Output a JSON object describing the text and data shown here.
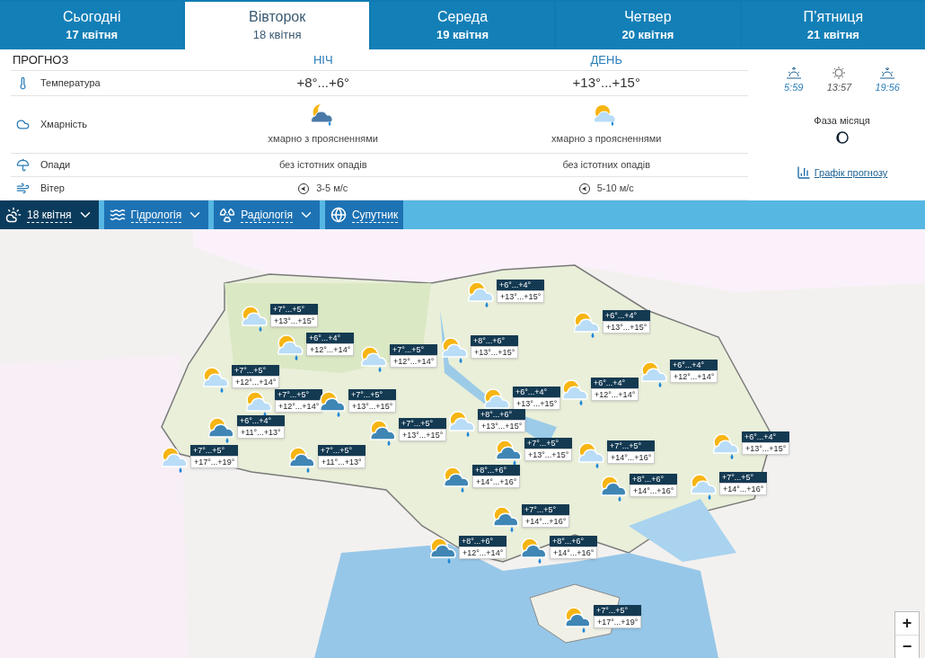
{
  "tabs": [
    {
      "day": "Сьогодні",
      "date": "17 квітня",
      "selected": false
    },
    {
      "day": "Вівторок",
      "date": "18 квітня",
      "selected": true
    },
    {
      "day": "Середа",
      "date": "19 квітня",
      "selected": false
    },
    {
      "day": "Четвер",
      "date": "20 квітня",
      "selected": false
    },
    {
      "day": "П’ятниця",
      "date": "21 квітня",
      "selected": false
    }
  ],
  "forecast": {
    "title": "ПРОГНОЗ",
    "columns": [
      "НІЧ",
      "ДЕНЬ"
    ],
    "rows": [
      {
        "kind": "temperature",
        "label": "Температура",
        "cells": [
          "+8°...+6°",
          "+13°...+15°"
        ]
      },
      {
        "kind": "cloudiness",
        "label": "Хмарність",
        "cells": [
          "хмарно з проясненнями",
          "хмарно з проясненнями"
        ]
      },
      {
        "kind": "precipitation",
        "label": "Опади",
        "cells": [
          "без істотних опадів",
          "без істотних опадів"
        ]
      },
      {
        "kind": "wind",
        "label": "Вітер",
        "cells": [
          "3-5 м/с",
          "5-10 м/с"
        ]
      }
    ]
  },
  "sun": [
    {
      "kind": "sunrise",
      "time": "5:59"
    },
    {
      "kind": "noon",
      "time": "13:57"
    },
    {
      "kind": "sunset",
      "time": "19:56"
    }
  ],
  "moon": {
    "label": "Фаза місяця"
  },
  "chart_link": "Графік прогнозу",
  "toolbar": [
    {
      "kind": "date",
      "label": "18 квітня",
      "selected": true,
      "menu": true
    },
    {
      "kind": "hydrology",
      "label": "Гідрологія",
      "selected": false,
      "menu": true
    },
    {
      "kind": "radiology",
      "label": "Радіологія",
      "selected": false,
      "menu": true
    },
    {
      "kind": "satellite",
      "label": "Супутник",
      "selected": false,
      "menu": false
    }
  ],
  "markers": [
    {
      "kind": "partly",
      "night": "+7°...+5°",
      "day": "+13°...+15°"
    },
    {
      "kind": "partly",
      "night": "+6°...+4°",
      "day": "+12°...+14°"
    },
    {
      "kind": "partly",
      "night": "+7°...+5°",
      "day": "+12°...+14°"
    },
    {
      "kind": "partly",
      "night": "+8°...+6°",
      "day": "+13°...+15°"
    },
    {
      "kind": "partly",
      "night": "+6°...+4°",
      "day": "+13°...+15°"
    },
    {
      "kind": "partly",
      "night": "+6°...+4°",
      "day": "+13°...+15°"
    },
    {
      "kind": "partly",
      "night": "+6°...+4°",
      "day": "+12°...+14°"
    },
    {
      "kind": "partly",
      "night": "+6°...+4°",
      "day": "+12°...+14°"
    },
    {
      "kind": "partly",
      "night": "+6°...+4°",
      "day": "+13°...+15°"
    },
    {
      "kind": "partly",
      "night": "+7°...+5°",
      "day": "+12°...+14°"
    },
    {
      "kind": "partly",
      "night": "+7°...+5°",
      "day": "+12°...+14°"
    },
    {
      "kind": "cloudy",
      "night": "+7°...+5°",
      "day": "+13°...+15°"
    },
    {
      "kind": "cloudy",
      "night": "+6°...+4°",
      "day": "+11°...+13°"
    },
    {
      "kind": "partly",
      "night": "+7°...+5°",
      "day": "+17°...+19°"
    },
    {
      "kind": "cloudy",
      "night": "+7°...+5°",
      "day": "+11°...+13°"
    },
    {
      "kind": "cloudy",
      "night": "+7°...+5°",
      "day": "+13°...+15°"
    },
    {
      "kind": "partly",
      "night": "+8°...+6°",
      "day": "+13°...+15°"
    },
    {
      "kind": "cloudy",
      "night": "+7°...+5°",
      "day": "+13°...+15°"
    },
    {
      "kind": "cloudy",
      "night": "+8°...+6°",
      "day": "+14°...+16°"
    },
    {
      "kind": "partly",
      "night": "+7°...+5°",
      "day": "+14°...+16°"
    },
    {
      "kind": "cloudy",
      "night": "+8°...+6°",
      "day": "+14°...+16°"
    },
    {
      "kind": "partly",
      "night": "+7°...+5°",
      "day": "+14°...+16°"
    },
    {
      "kind": "partly",
      "night": "+6°...+4°",
      "day": "+13°...+15°"
    },
    {
      "kind": "cloudy",
      "night": "+7°...+5°",
      "day": "+14°...+16°"
    },
    {
      "kind": "cloudy",
      "night": "+8°...+6°",
      "day": "+12°...+14°"
    },
    {
      "kind": "cloudy",
      "night": "+8°...+6°",
      "day": "+14°...+16°"
    },
    {
      "kind": "cloudy",
      "night": "+7°...+5°",
      "day": "+17°...+19°"
    }
  ],
  "map_controls": [
    "+",
    "−"
  ]
}
